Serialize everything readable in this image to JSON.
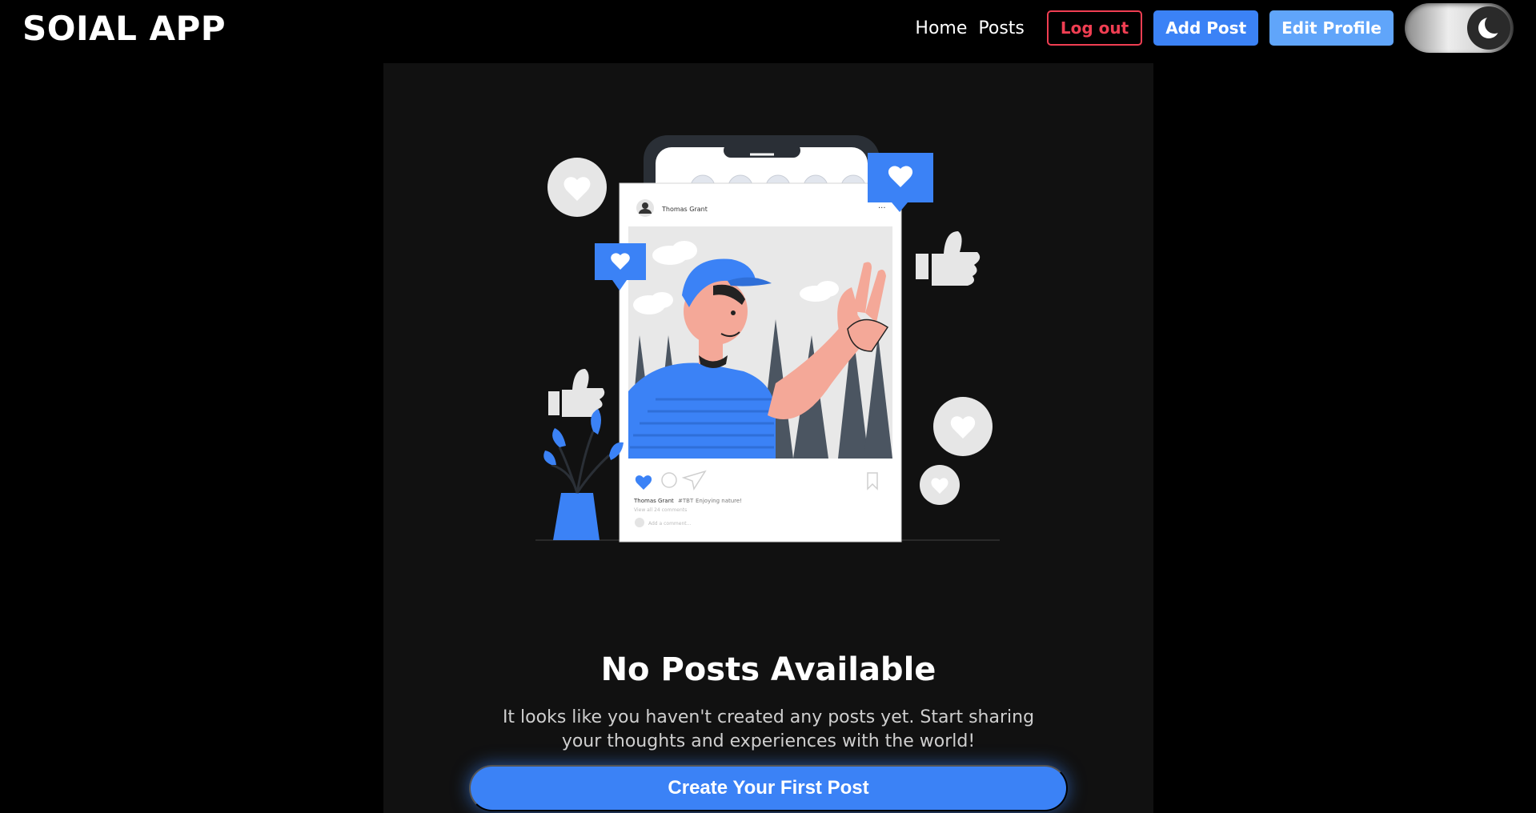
{
  "navbar": {
    "brand": "SOIAL APP",
    "links": {
      "home": "Home",
      "posts": "Posts"
    },
    "buttons": {
      "logout": "Log out",
      "add_post": "Add Post",
      "edit_profile": "Edit Profile"
    },
    "theme_toggle": {
      "icon": "moon-icon",
      "state": "dark"
    }
  },
  "illustration": {
    "post_card": {
      "username": "Thomas Grant",
      "caption_user": "Thomas Grant",
      "caption_tag": "#TBT",
      "caption_text": "Enjoying nature!",
      "comments_text": "View all 24 comments",
      "add_comment": "Add a comment..."
    }
  },
  "empty_state": {
    "title": "No Posts Available",
    "description": "It looks like you haven't created any posts yet. Start sharing your thoughts and experiences with the world!",
    "cta_label": "Create Your First Post"
  },
  "colors": {
    "accent": "#3b82f6",
    "accent_light": "#60a5fa",
    "danger": "#f03e52",
    "panel_bg": "#111111",
    "page_bg": "#000000"
  }
}
